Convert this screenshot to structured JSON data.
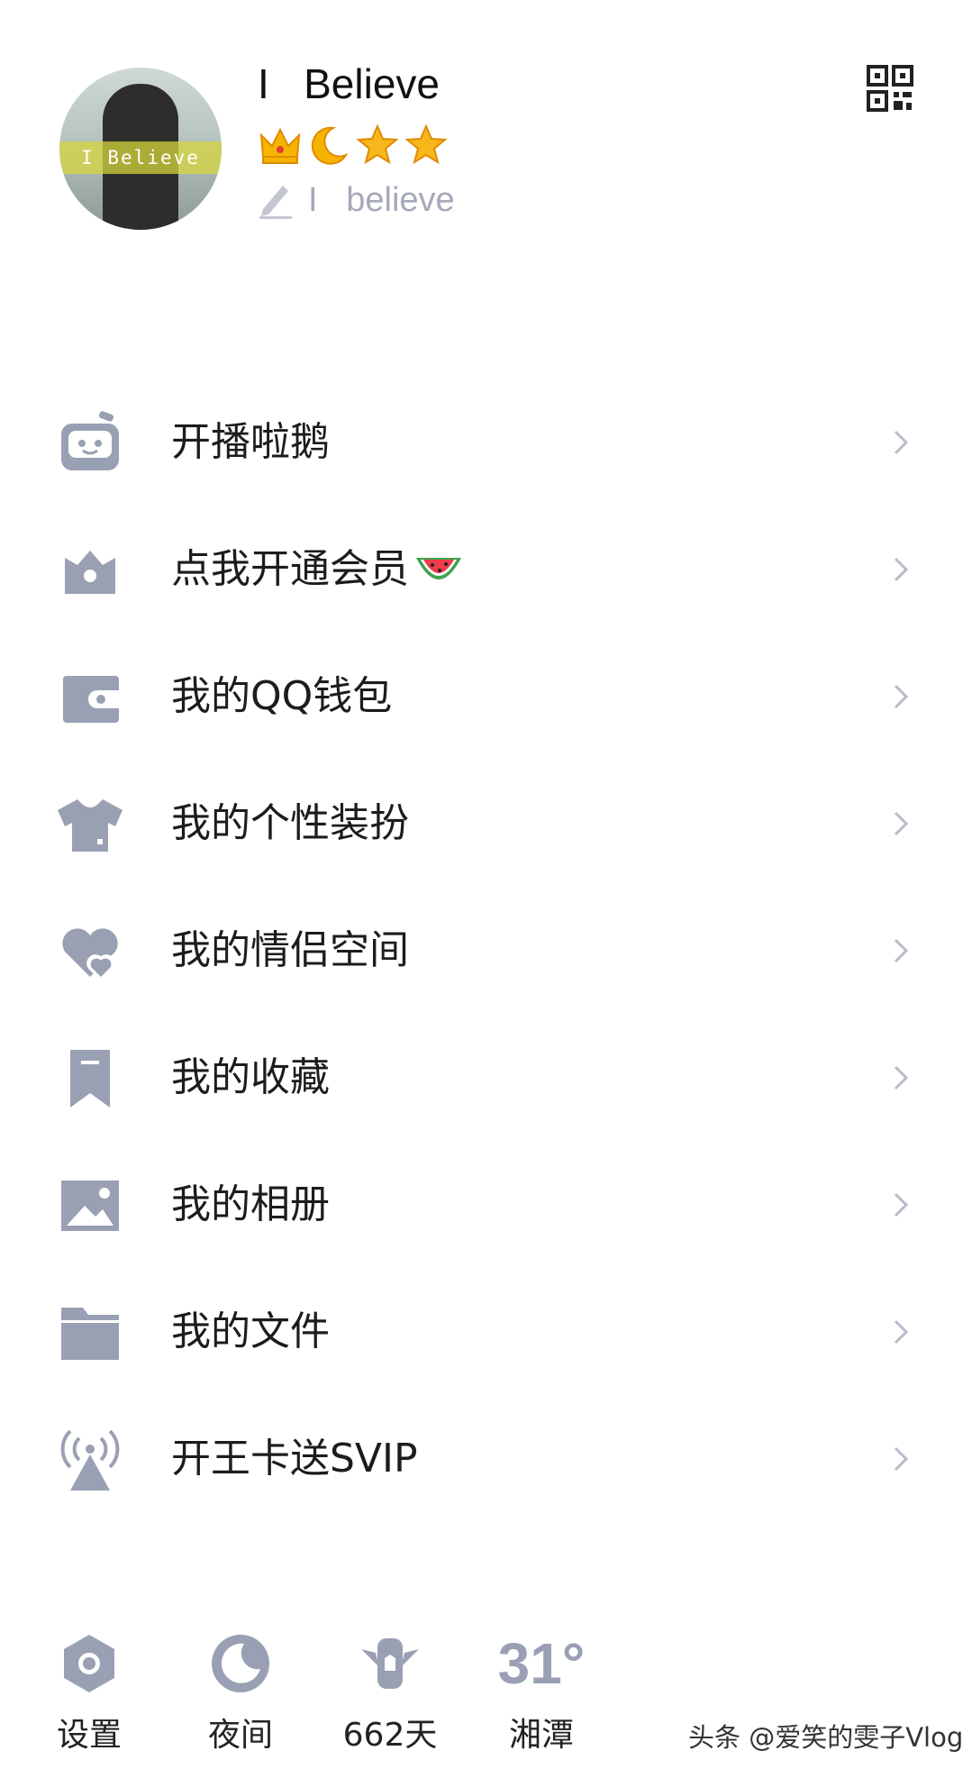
{
  "profile": {
    "name": "I   Believe",
    "avatar_text": "I Believe",
    "badges": [
      "crown-icon",
      "moon-icon",
      "star-icon",
      "star-icon"
    ],
    "signature": "I   believe"
  },
  "menu": [
    {
      "label": "开播啦鹅",
      "icon": "live-robot-icon"
    },
    {
      "label": "点我开通会员",
      "icon": "vip-crown-icon"
    },
    {
      "label": "我的QQ钱包",
      "icon": "wallet-icon"
    },
    {
      "label": "我的个性装扮",
      "icon": "tshirt-icon"
    },
    {
      "label": "我的情侣空间",
      "icon": "hearts-icon"
    },
    {
      "label": "我的收藏",
      "icon": "bookmark-icon"
    },
    {
      "label": "我的相册",
      "icon": "photo-icon"
    },
    {
      "label": "我的文件",
      "icon": "folder-icon"
    },
    {
      "label": "开王卡送SVIP",
      "icon": "signal-tower-icon"
    }
  ],
  "dock": {
    "settings": "设置",
    "night": "夜间",
    "days": "662天",
    "weather_temp": "31°",
    "weather_city": "湘潭"
  },
  "watermark": "头条 @爱笑的雯子Vlog",
  "colors": {
    "icon": "#9aa0b3",
    "chevron": "#b8bcc8",
    "text": "#1c1c1c",
    "signature": "#a5a9b9"
  }
}
